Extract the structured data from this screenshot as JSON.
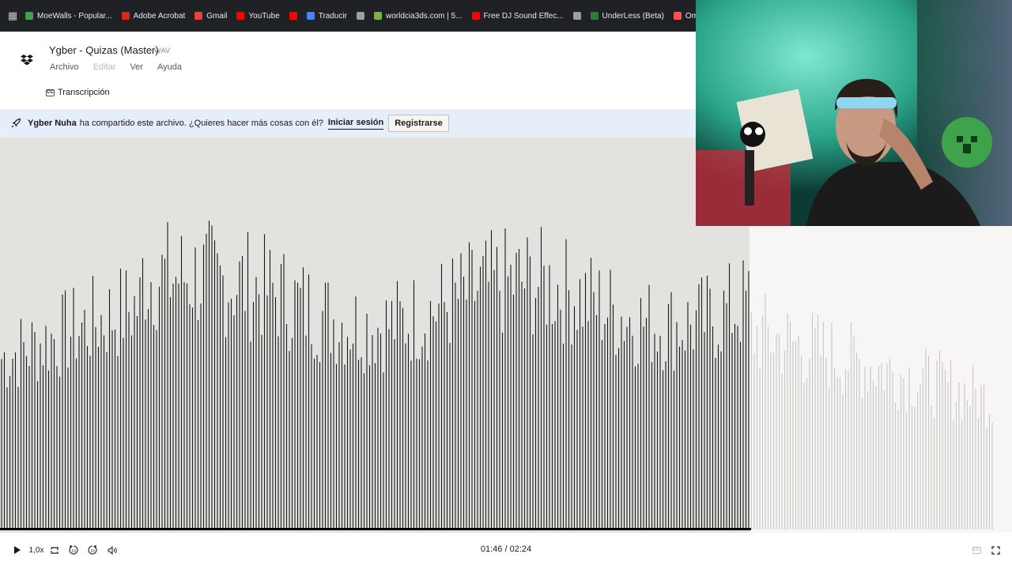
{
  "bookmarks": [
    {
      "label": "MoeWalls - Popular...",
      "color": "#3fa34d"
    },
    {
      "label": "Adobe Acrobat",
      "color": "#e0261b"
    },
    {
      "label": "Gmail",
      "color": "#ea4335"
    },
    {
      "label": "YouTube",
      "color": "#ff0000"
    },
    {
      "label": "",
      "color": "#ff0000"
    },
    {
      "label": "Traducir",
      "color": "#4285f4"
    },
    {
      "label": "",
      "color": "#9aa0a6"
    },
    {
      "label": "worldcia3ds.com | 5...",
      "color": "#7cb342"
    },
    {
      "label": "Free DJ Sound Effec...",
      "color": "#ff0000"
    },
    {
      "label": "",
      "color": "#9aa0a6"
    },
    {
      "label": "UnderLess (Beta)",
      "color": "#2e7d32"
    },
    {
      "label": "OmeTV Video Chat...",
      "color": "#ff5252"
    }
  ],
  "file": {
    "title": "Ygber - Quizas (Master)",
    "ext": "WAV"
  },
  "menu": {
    "archivo": "Archivo",
    "editar": "Editar",
    "ver": "Ver",
    "ayuda": "Ayuda"
  },
  "transcript_label": "Transcripción",
  "banner": {
    "user": "Ygber Nuha",
    "message": "ha compartido este archivo. ¿Quieres hacer más cosas con él?",
    "login": "Iniciar sesión",
    "signup": "Registrarse"
  },
  "player": {
    "speed": "1,0x",
    "skip_back": "10",
    "skip_forward": "10",
    "current_time": "01:46",
    "separator": " / ",
    "total_time": "02:24",
    "progress": 0.74
  },
  "colors": {
    "played_bar": "#1a1a1a",
    "unplayed_bar": "#c8c5c2",
    "banner_bg": "#e6eefa",
    "wave_bg": "#e4e2df"
  }
}
